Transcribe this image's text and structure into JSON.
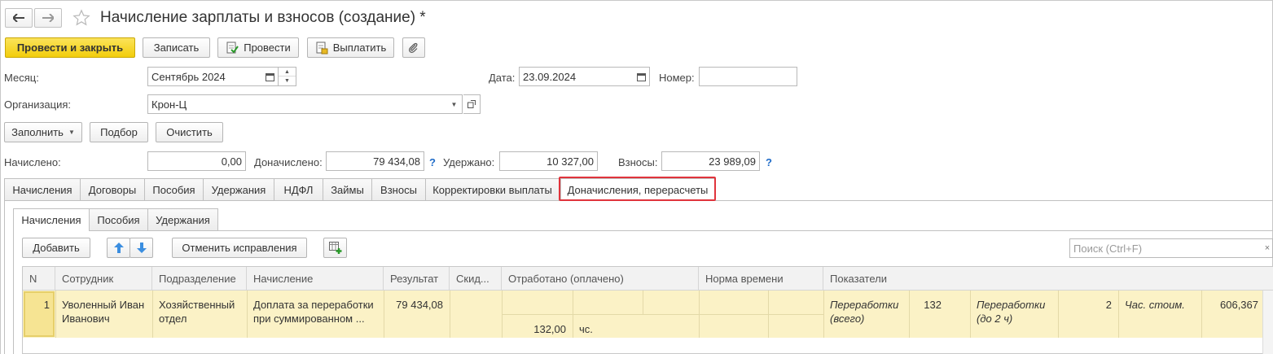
{
  "window": {
    "title": "Начисление зарплаты и взносов (создание) *",
    "back_icon": "arrow-left-icon",
    "forward_icon": "arrow-right-icon",
    "favorite_icon": "star-icon"
  },
  "toolbar": {
    "post_close": "Провести и закрыть",
    "save": "Записать",
    "post": "Провести",
    "pay": "Выплатить",
    "attach_icon": "paperclip-icon"
  },
  "form": {
    "month_label": "Месяц:",
    "month_value": "Сентябрь 2024",
    "date_label": "Дата:",
    "date_value": "23.09.2024",
    "number_label": "Номер:",
    "number_value": "",
    "org_label": "Организация:",
    "org_value": "Крон-Ц"
  },
  "actions": {
    "fill": "Заполнить",
    "pick": "Подбор",
    "clear": "Очистить"
  },
  "totals": {
    "accrued_label": "Начислено:",
    "accrued_value": "0,00",
    "extra_label": "Доначислено:",
    "extra_value": "79 434,08",
    "withheld_label": "Удержано:",
    "withheld_value": "10 327,00",
    "contrib_label": "Взносы:",
    "contrib_value": "23 989,09",
    "help": "?"
  },
  "tabs": [
    "Начисления",
    "Договоры",
    "Пособия",
    "Удержания",
    "НДФЛ",
    "Займы",
    "Взносы",
    "Корректировки выплаты",
    "Доначисления, перерасчеты"
  ],
  "subtabs": [
    "Начисления",
    "Пособия",
    "Удержания"
  ],
  "table_toolbar": {
    "add": "Добавить",
    "cancel_corrections": "Отменить исправления",
    "search_placeholder": "Поиск (Ctrl+F)"
  },
  "table": {
    "columns": [
      "N",
      "Сотрудник",
      "Подразделение",
      "Начисление",
      "Результат",
      "Скид...",
      "Отработано (оплачено)",
      "Норма времени",
      "Показатели"
    ],
    "rows": [
      {
        "n": "1",
        "employee": "Уволенный Иван Иванович",
        "department": "Хозяйственный отдел",
        "accrual": "Доплата за переработки при суммированном ...",
        "result": "79 434,08",
        "worked_value": "132,00",
        "worked_unit": "чс.",
        "ind1_name": "Переработки (всего)",
        "ind1_value": "132",
        "ind2_name": "Переработки (до 2 ч)",
        "ind2_value": "2",
        "ind3_name": "Час. стоим.",
        "ind3_value": "606,367"
      }
    ]
  },
  "colors": {
    "accent_yellow": "#f5d41c",
    "row_highlight": "#fbf2c6",
    "selected_cell": "#f6e493",
    "tab_highlight_border": "#e0343c"
  }
}
